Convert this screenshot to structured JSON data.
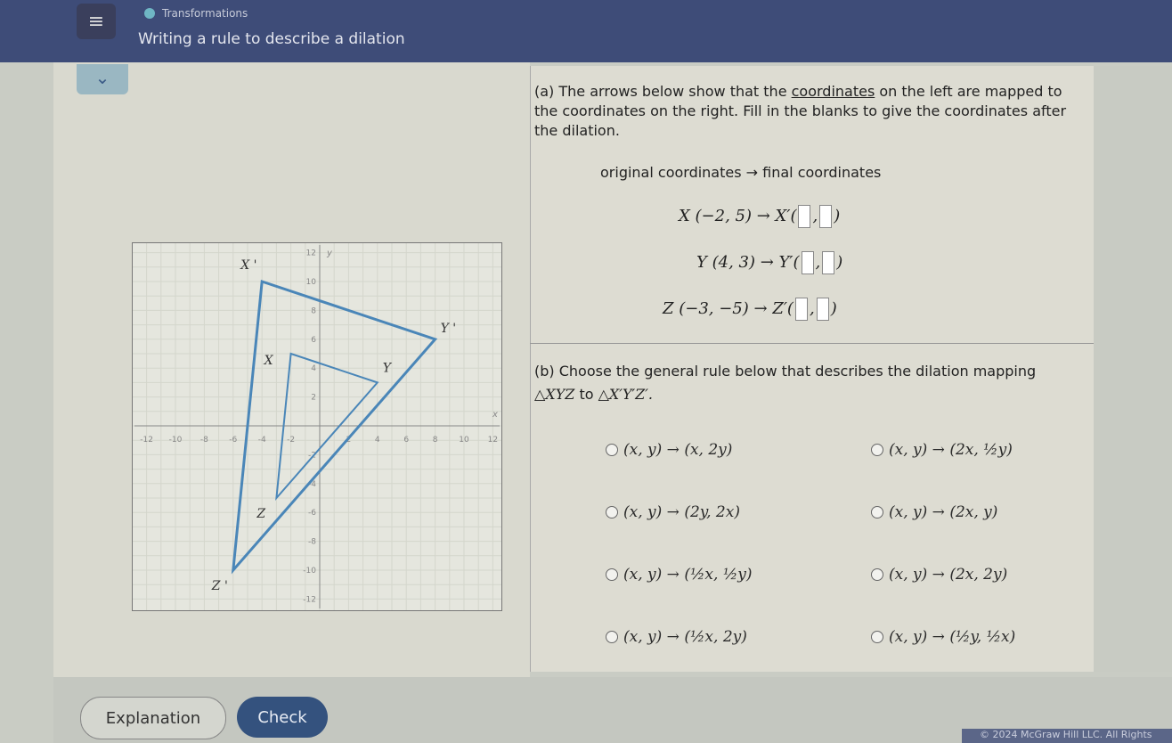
{
  "header": {
    "topic": "Transformations",
    "title": "Writing a rule to describe a dilation"
  },
  "part_a": {
    "label": "(a)",
    "instruction_pre": "The arrows below show that the ",
    "instruction_link": "coordinates",
    "instruction_post": " on the left are mapped to the coordinates on the right. Fill in the blanks to give the coordinates after the dilation.",
    "heading_left": "original coordinates",
    "heading_arrow": "→",
    "heading_right": "final coordinates",
    "rows": [
      {
        "original": "X (−2, 5)",
        "image": "X′"
      },
      {
        "original": "Y (4, 3)",
        "image": "Y′"
      },
      {
        "original": "Z (−3, −5)",
        "image": "Z′"
      }
    ]
  },
  "part_b": {
    "label": "(b)",
    "instruction": "Choose the general rule below that describes the dilation mapping",
    "from": "△XYZ",
    "to_word": "to",
    "to": "△X′Y′Z′.",
    "options": [
      "(x, y) → (x, 2y)",
      "(x, y) → (2x, ½y)",
      "(x, y) → (2y, 2x)",
      "(x, y) → (2x, y)",
      "(x, y) → (½x, ½y)",
      "(x, y) → (2x, 2y)",
      "(x, y) → (½x, 2y)",
      "(x, y) → (½y, ½x)"
    ]
  },
  "graph": {
    "range": [
      -12,
      12
    ],
    "tick_labels": [
      "-12",
      "-10",
      "-8",
      "-6",
      "-4",
      "-2",
      "2",
      "4",
      "6",
      "8",
      "10",
      "12"
    ],
    "axis_x": "x",
    "axis_y": "y",
    "original": {
      "X": [
        -2,
        5
      ],
      "Y": [
        4,
        3
      ],
      "Z": [
        -3,
        -5
      ]
    },
    "image": {
      "X'": [
        -4,
        10
      ],
      "Y'": [
        8,
        6
      ],
      "Z'": [
        -6,
        -10
      ]
    },
    "labels": {
      "X": "X",
      "Y": "Y",
      "Z": "Z",
      "X'": "X '",
      "Y'": "Y '",
      "Z'": "Z '"
    },
    "color": "#4a86b8"
  },
  "buttons": {
    "explanation": "Explanation",
    "check": "Check"
  },
  "footer": "© 2024 McGraw Hill LLC. All Rights"
}
